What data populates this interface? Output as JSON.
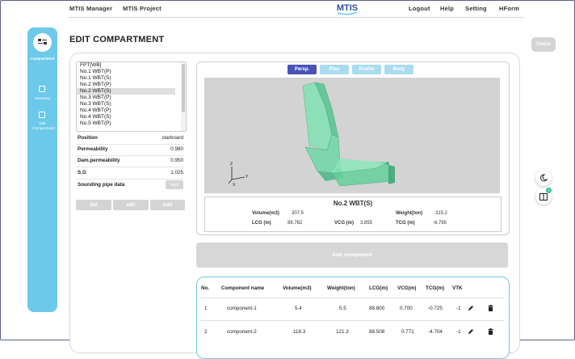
{
  "nav": {
    "left_links": [
      "MTIS Manager",
      "MTIS Project"
    ],
    "right_links": [
      "Logout",
      "Help",
      "Setting",
      "HForm"
    ],
    "logo_text": "MTIS"
  },
  "sidebar": {
    "items": [
      {
        "label": "Compartment",
        "icon": "layers-icon",
        "active": true
      },
      {
        "label": "Summary",
        "icon": "summary-icon",
        "active": false
      },
      {
        "label": "Edit Compartment",
        "icon": "edit-compartment-icon",
        "active": false
      }
    ]
  },
  "page": {
    "title": "EDIT COMPARTMENT",
    "status_label": "Status"
  },
  "compartments": {
    "items": [
      "FPT[WB]",
      "No.1 WBT(P)",
      "No.1 WBT(S)",
      "No.2 WBT(P)",
      "No.2 WBT(S)",
      "No.3 WBT(P)",
      "No.3 WBT(S)",
      "No.4 WBT(P)",
      "No.4 WBT(S)",
      "No.5 WBT(P)"
    ],
    "selected": "No.2 WBT(S)"
  },
  "properties": [
    {
      "label": "Position",
      "value": "starboard"
    },
    {
      "label": "Permeability",
      "value": "0.980"
    },
    {
      "label": "Dam.permeability",
      "value": "0.950"
    },
    {
      "label": "S.G",
      "value": "1.025"
    },
    {
      "label": "Sounding pipe data",
      "button": "input"
    }
  ],
  "actions": {
    "del": "Del",
    "edit": "edit",
    "add": "Add"
  },
  "viewer": {
    "tabs": [
      {
        "label": "Persp.",
        "active": true
      },
      {
        "label": "Plan",
        "active": false
      },
      {
        "label": "Profile",
        "active": false
      },
      {
        "label": "Body",
        "active": false
      }
    ],
    "axes": {
      "x": "X",
      "y": "Y",
      "z": "Z"
    }
  },
  "info": {
    "name": "No.2 WBT(S)",
    "volume_label": "Volume(m3)",
    "volume": "307.5",
    "weight_label": "Weight(ton)",
    "weight": "315.2",
    "lcg_label": "LCG (m)",
    "lcg": "88.782",
    "vcg_label": "VCG (m)",
    "vcg": "3.855",
    "tcg_label": "TCG (m)",
    "tcg": "-6.785"
  },
  "add_component_label": "Add component",
  "table": {
    "headers": [
      "No.",
      "Component name",
      "Volume(m3)",
      "Weight(ton)",
      "LCG(m)",
      "VCG(m)",
      "TCG(m)",
      "VTK"
    ],
    "rows": [
      {
        "no": "1",
        "name": "component-1",
        "volume": "5.4",
        "weight": "5.5",
        "lcg": "88.800",
        "vcg": "0.700",
        "tcg": "-0.725",
        "vtk": "-1"
      },
      {
        "no": "2",
        "name": "component-2",
        "volume": "118.3",
        "weight": "121.3",
        "lcg": "88.508",
        "vcg": "0.771",
        "tcg": "-4.704",
        "vtk": "-1"
      }
    ]
  },
  "colors": {
    "accent": "#6cc9ea",
    "active_tab": "#4a52b8",
    "inactive_tab": "#a9dcef",
    "disabled": "#d4d4d4",
    "model_fill": "#6fd6a4"
  },
  "side_buttons": {
    "theme_icon": "moon-icon",
    "book_icon": "book-icon",
    "badge": "4"
  }
}
